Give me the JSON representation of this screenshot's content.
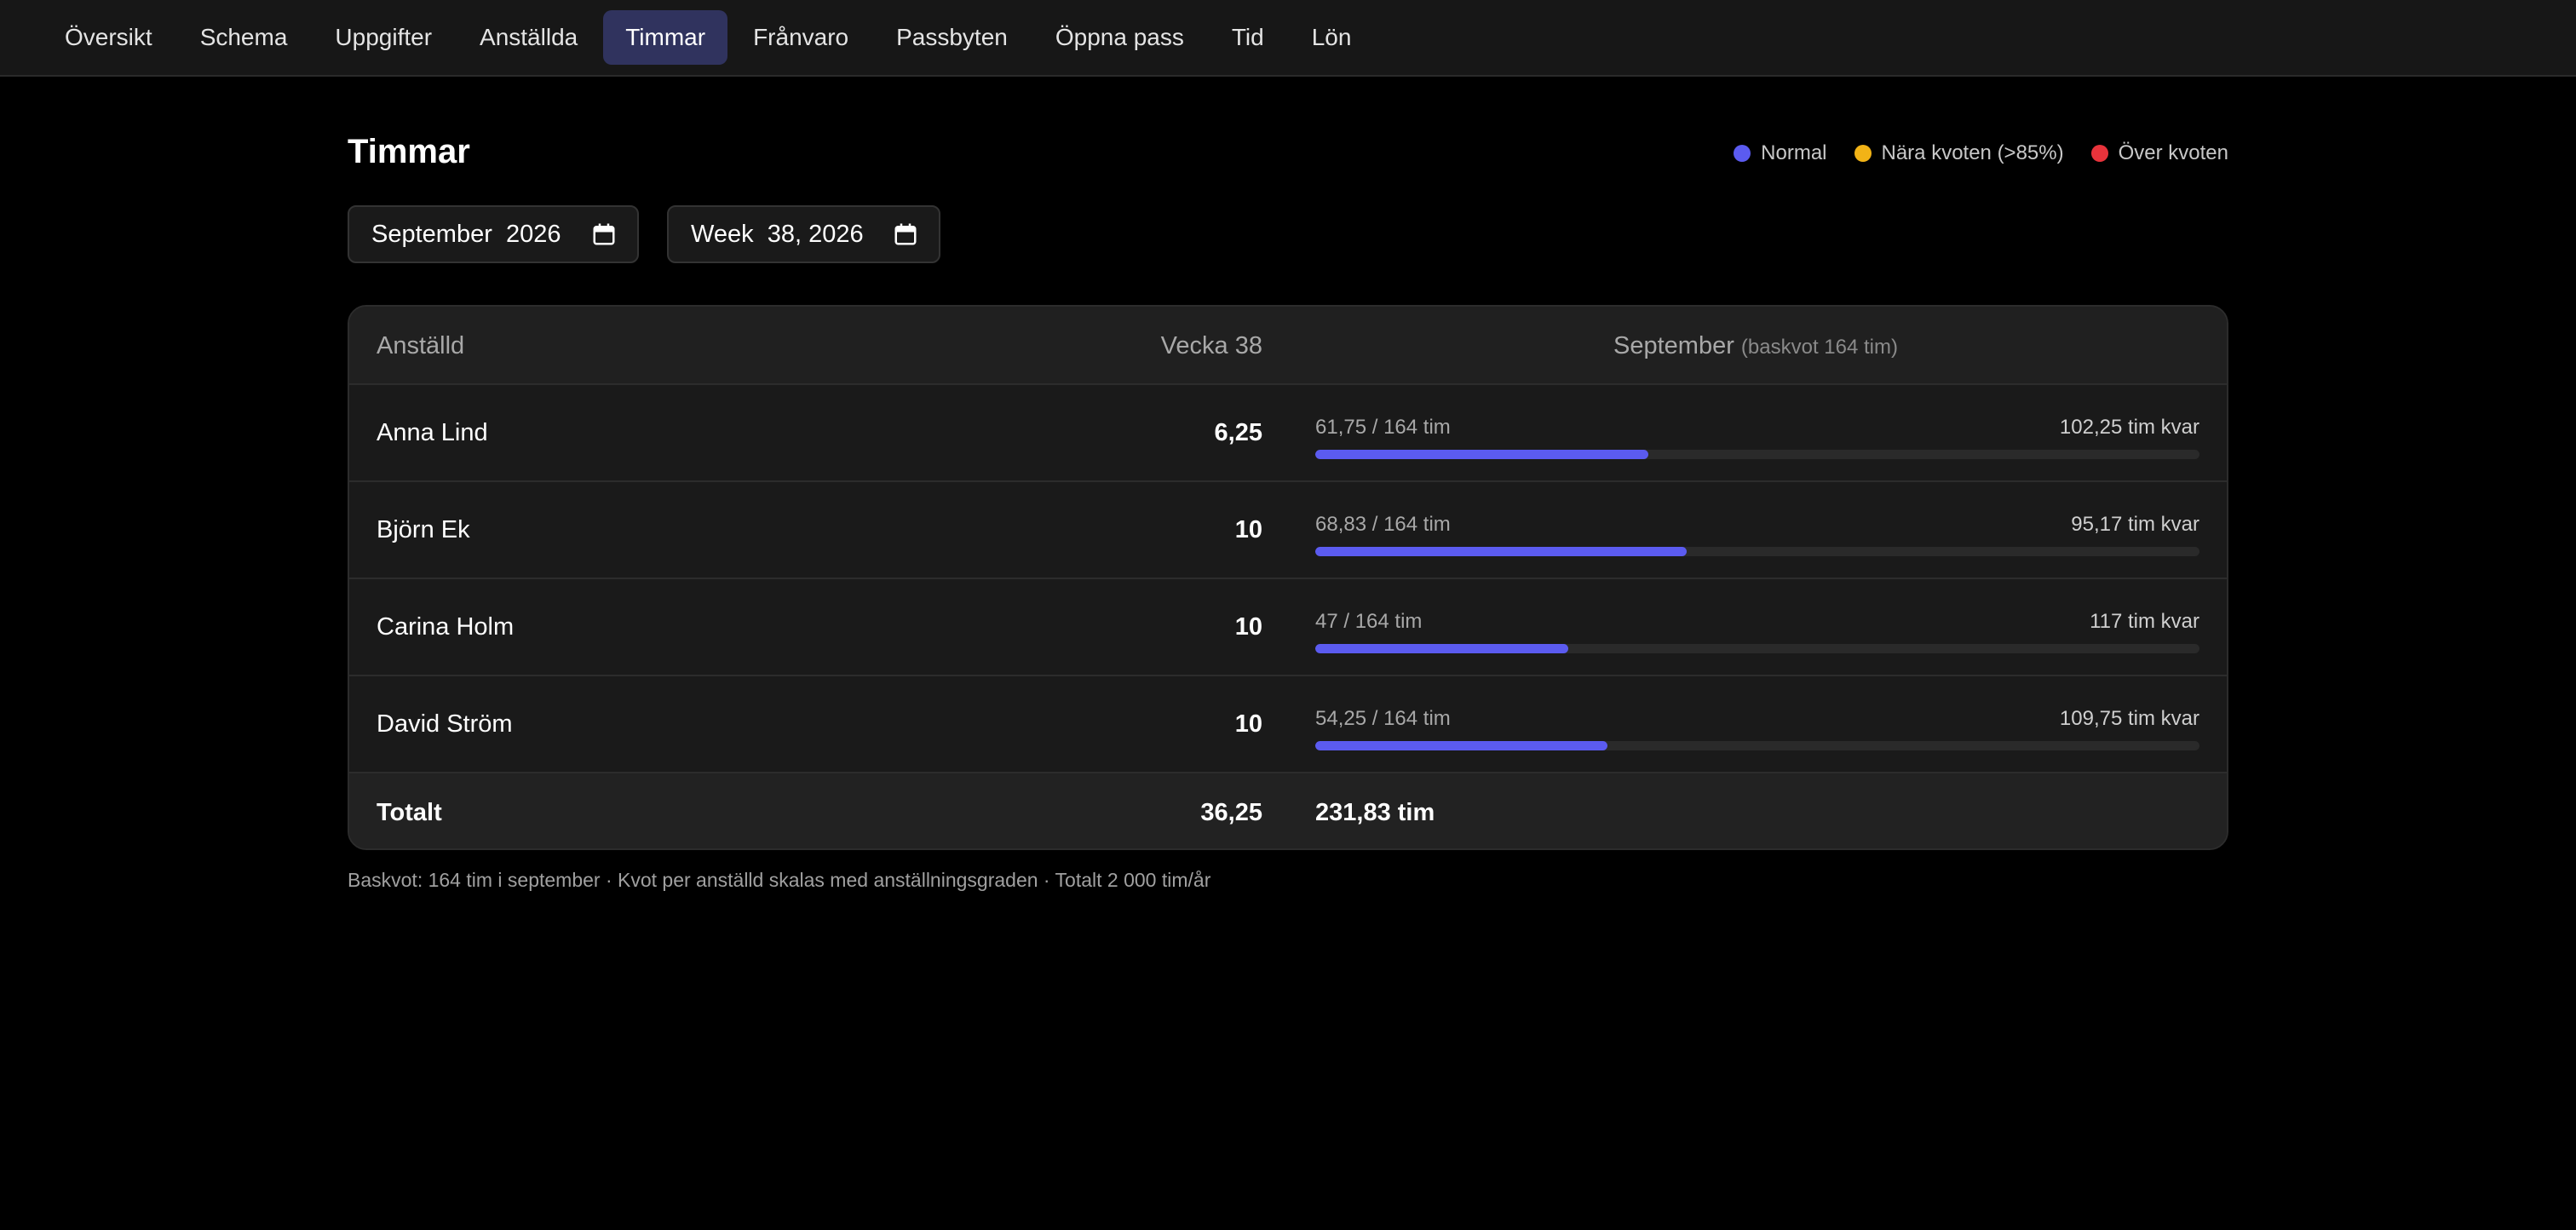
{
  "nav": {
    "items": [
      {
        "label": "Översikt",
        "active": false
      },
      {
        "label": "Schema",
        "active": false
      },
      {
        "label": "Uppgifter",
        "active": false
      },
      {
        "label": "Anställda",
        "active": false
      },
      {
        "label": "Timmar",
        "active": true
      },
      {
        "label": "Frånvaro",
        "active": false
      },
      {
        "label": "Passbyten",
        "active": false
      },
      {
        "label": "Öppna pass",
        "active": false
      },
      {
        "label": "Tid",
        "active": false
      },
      {
        "label": "Lön",
        "active": false
      }
    ]
  },
  "page": {
    "title": "Timmar"
  },
  "legend": [
    {
      "label": "Normal",
      "color": "#5b5bf0"
    },
    {
      "label": "Nära kvoten (>85%)",
      "color": "#f2b316"
    },
    {
      "label": "Över kvoten",
      "color": "#e8333b"
    }
  ],
  "pickers": {
    "month_value": "September  2026",
    "week_value": "Week  38, 2026",
    "icon": "calendar-icon"
  },
  "table": {
    "headers": {
      "employee": "Anställd",
      "week": "Vecka 38",
      "month": "September",
      "month_sub": "(baskvot 164 tim)"
    },
    "rows": [
      {
        "name": "Anna Lind",
        "week": "6,25",
        "month_used": "61,75 / 164 tim",
        "month_left": "102,25 tim kvar",
        "fraction": 0.3765
      },
      {
        "name": "Björn Ek",
        "week": "10",
        "month_used": "68,83 / 164 tim",
        "month_left": "95,17 tim kvar",
        "fraction": 0.4197
      },
      {
        "name": "Carina Holm",
        "week": "10",
        "month_used": "47 / 164 tim",
        "month_left": "117 tim kvar",
        "fraction": 0.2866
      },
      {
        "name": "David Ström",
        "week": "10",
        "month_used": "54,25 / 164 tim",
        "month_left": "109,75 tim kvar",
        "fraction": 0.3308
      }
    ],
    "total": {
      "label": "Totalt",
      "week": "36,25",
      "month": "231,83 tim"
    },
    "bar_color": "#5b5bf0"
  },
  "footnote": "Baskvot: 164 tim i september · Kvot per anställd skalas med anställningsgraden · Totalt 2 000 tim/år"
}
